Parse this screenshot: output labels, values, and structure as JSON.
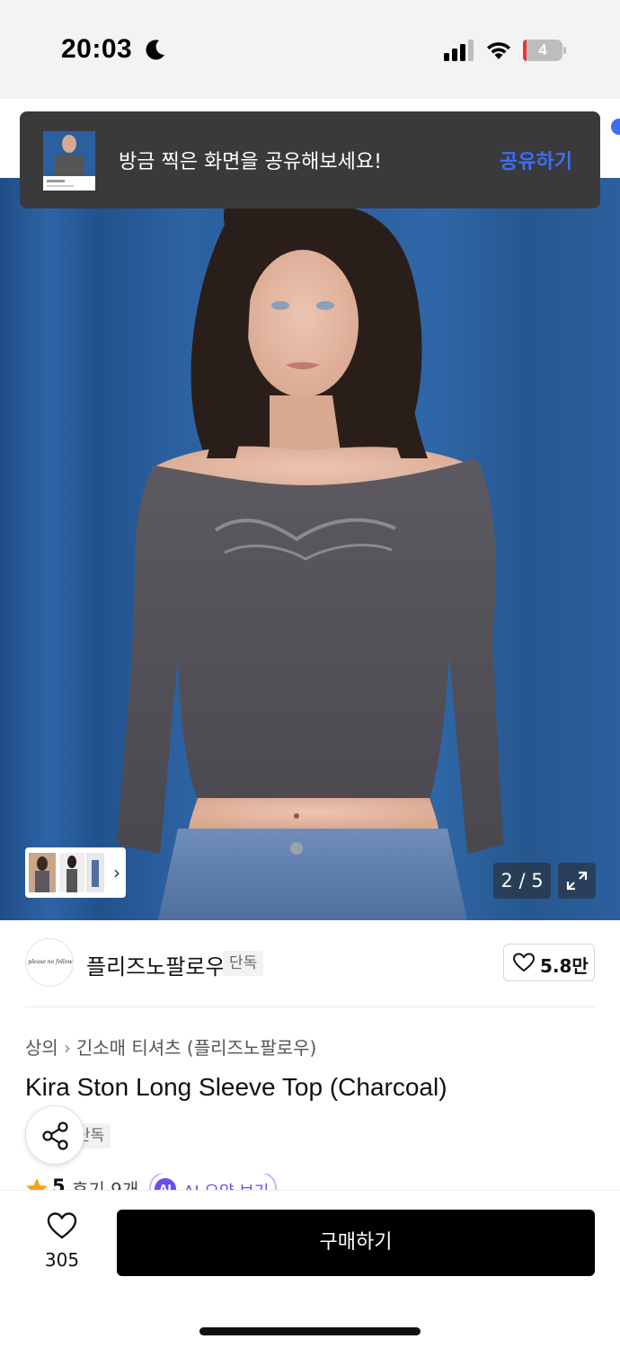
{
  "status_bar": {
    "time": "20:03",
    "battery": "4",
    "battery_level": 0.04,
    "icons": [
      "moon-icon",
      "signal-icon",
      "wifi-icon",
      "battery-icon"
    ]
  },
  "toast": {
    "message": "방금 찍은 화면을 공유해보세요!",
    "action": "공유하기",
    "accent": "#3b6ef5"
  },
  "gallery": {
    "counter": "2 / 5",
    "current": 2,
    "total": 5
  },
  "brand": {
    "name": "플리즈노팔로우",
    "badge": "단독",
    "likes": "5.8만"
  },
  "breadcrumb": {
    "category": "상의",
    "subcategory": "긴소매 티셔츠 (플리즈노팔로우)"
  },
  "product": {
    "title": "Kira Ston Long Sleeve Top (Charcoal)",
    "badge": "단독",
    "rating": "5",
    "reviews": "후기 9개",
    "ai_icon": "AI",
    "ai_summary": "AI 요약 보기"
  },
  "bottom_bar": {
    "wish_count": "305",
    "buy_label": "구매하기"
  }
}
